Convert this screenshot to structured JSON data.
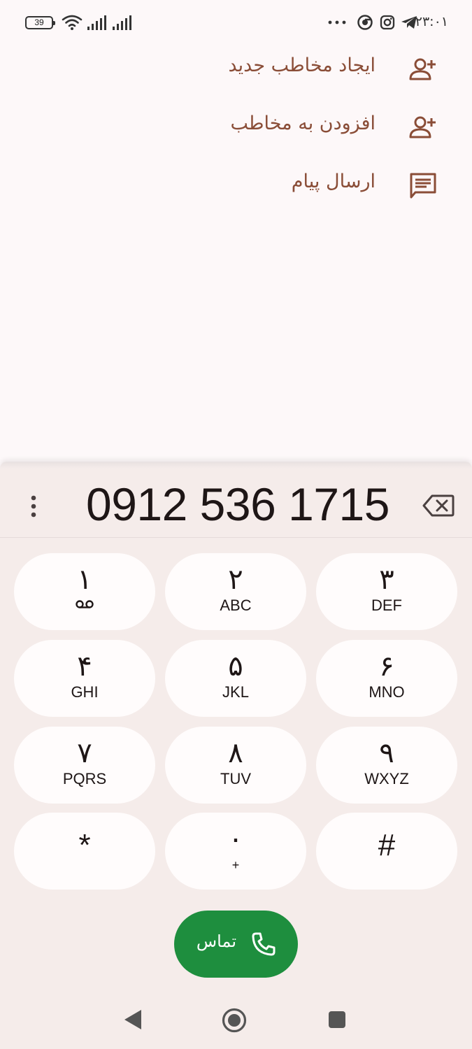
{
  "status_bar": {
    "battery": "39",
    "clock": "۲۳:۰۱",
    "icons": [
      "wifi-icon",
      "signal-icon",
      "signal-icon",
      "more-dots-icon",
      "chrome-icon",
      "instagram-icon",
      "telegram-icon"
    ]
  },
  "actions": [
    {
      "label": "ایجاد مخاطب جدید",
      "icon": "person-add-icon"
    },
    {
      "label": "افزودن به مخاطب",
      "icon": "person-add-icon"
    },
    {
      "label": "ارسال پیام",
      "icon": "message-icon"
    }
  ],
  "dialer": {
    "number": "0912 536 1715",
    "keys": [
      {
        "digit": "۱",
        "letters": ""
      },
      {
        "digit": "۲",
        "letters": "ABC"
      },
      {
        "digit": "۳",
        "letters": "DEF"
      },
      {
        "digit": "۴",
        "letters": "GHI"
      },
      {
        "digit": "۵",
        "letters": "JKL"
      },
      {
        "digit": "۶",
        "letters": "MNO"
      },
      {
        "digit": "۷",
        "letters": "PQRS"
      },
      {
        "digit": "۸",
        "letters": "TUV"
      },
      {
        "digit": "۹",
        "letters": "WXYZ"
      },
      {
        "digit": "*",
        "letters": ""
      },
      {
        "digit": "۰",
        "letters": "+"
      },
      {
        "digit": "#",
        "letters": ""
      }
    ],
    "call_label": "تماس"
  },
  "colors": {
    "accent": "#8a4d37",
    "call_green": "#1e8e3e",
    "sheet_bg": "#f5ecea",
    "key_bg": "#fffcfc"
  }
}
